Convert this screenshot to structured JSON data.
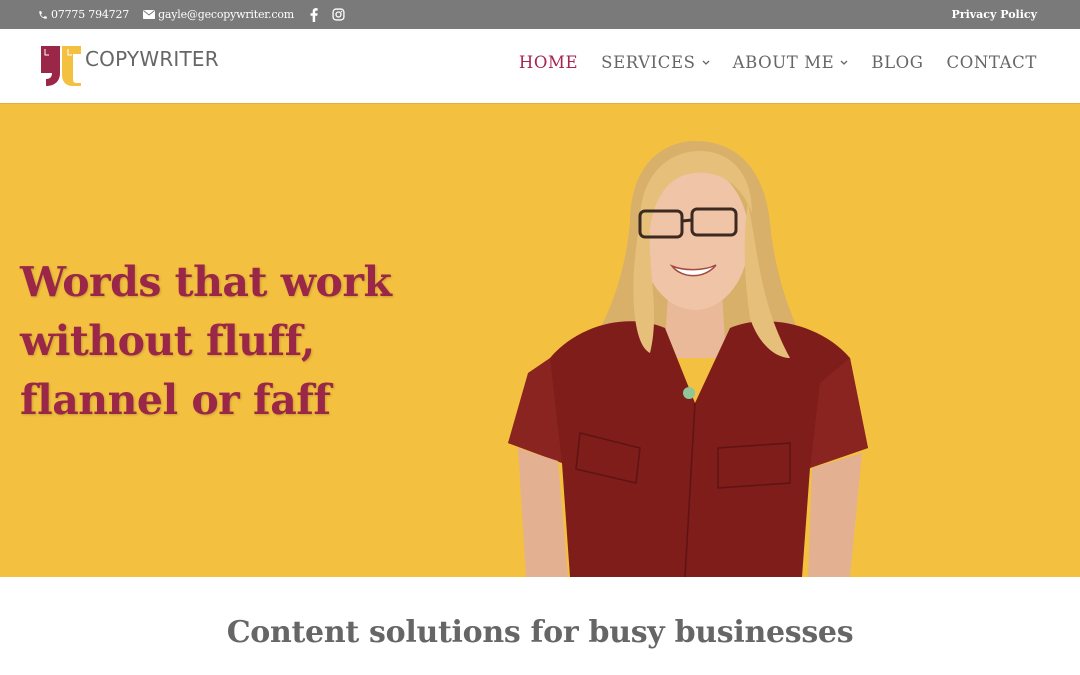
{
  "topbar": {
    "phone": "07775 794727",
    "email": "gayle@gecopywriter.com",
    "social": [
      "facebook-icon",
      "instagram-icon"
    ],
    "privacy_label": "Privacy Policy",
    "bg_color": "#7a7a7a"
  },
  "header": {
    "logo_text": "COPYWRITER",
    "logo_colors": {
      "left": "#9a2648",
      "right": "#f3c13f"
    },
    "nav": [
      {
        "label": "HOME",
        "active": true,
        "has_dropdown": false
      },
      {
        "label": "SERVICES",
        "active": false,
        "has_dropdown": true
      },
      {
        "label": "ABOUT ME",
        "active": false,
        "has_dropdown": true
      },
      {
        "label": "BLOG",
        "active": false,
        "has_dropdown": false
      },
      {
        "label": "CONTACT",
        "active": false,
        "has_dropdown": false
      }
    ],
    "chevron": "⌄"
  },
  "hero": {
    "title_lines": [
      "Words that work",
      "without fluff,",
      "flannel or faff"
    ],
    "photo_alt": "Smiling woman with blonde hair and glasses wearing a dark red shirt",
    "bg_color": "#f3c13f",
    "title_color": "#9a2648"
  },
  "section": {
    "heading": "Content solutions for busy businesses"
  }
}
